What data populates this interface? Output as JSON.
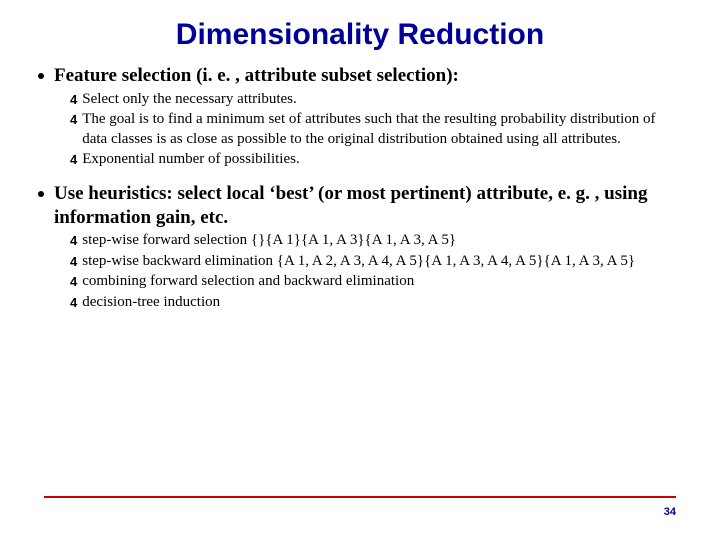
{
  "title": "Dimensionality Reduction",
  "sections": [
    {
      "heading": "Feature selection (i. e. , attribute subset selection):",
      "items": [
        "Select only the necessary attributes.",
        "The goal is to find a minimum set of attributes such that the resulting probability distribution of data classes is as close as possible to the original distribution obtained using all attributes.",
        "Exponential number of possibilities."
      ]
    },
    {
      "heading": "Use heuristics: select local ‘best’ (or most pertinent) attribute, e. g. , using information gain, etc.",
      "items": [
        "step-wise forward selection {}{A 1}{A 1, A 3}{A 1, A 3, A 5}",
        "step-wise backward elimination {A 1, A 2, A 3, A 4, A 5}{A 1, A 3, A 4, A 5}{A 1, A 3, A 5}",
        "combining forward selection and backward elimination",
        "decision-tree induction"
      ]
    }
  ],
  "pageNumber": "34"
}
